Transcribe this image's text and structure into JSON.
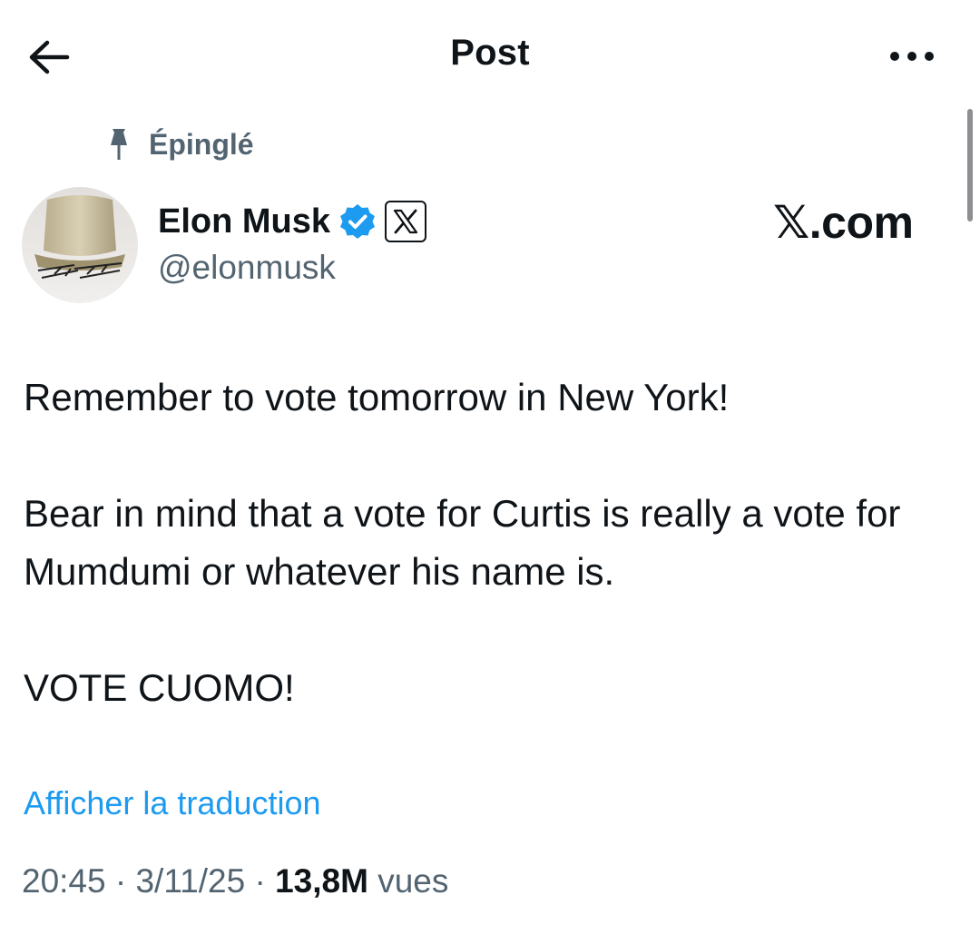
{
  "header": {
    "title": "Post",
    "back_icon": "arrow-left-icon",
    "more_icon": "more-horizontal-icon"
  },
  "pinned": {
    "label": "Épinglé",
    "icon": "pin-icon"
  },
  "author": {
    "name": "Elon Musk",
    "handle": "@elonmusk",
    "verified_icon": "verified-badge-icon",
    "affiliate_icon": "x-logo-icon",
    "verified_color": "#1d9bf0"
  },
  "watermark": "𝕏.com",
  "post": {
    "paragraphs": [
      "Remember to vote tomorrow in New York!",
      "Bear in mind that a vote for Curtis is really a vote for Mumdumi or whatever his name is.",
      "VOTE CUOMO!"
    ],
    "translate_label": "Afficher la traduction"
  },
  "meta": {
    "time": "20:45",
    "separator": " · ",
    "date": "3/11/25",
    "views_count": "13,8M",
    "views_label": "vues"
  },
  "colors": {
    "link": "#1d9bf0",
    "secondary_text": "#536471",
    "primary_text": "#0f1419"
  }
}
